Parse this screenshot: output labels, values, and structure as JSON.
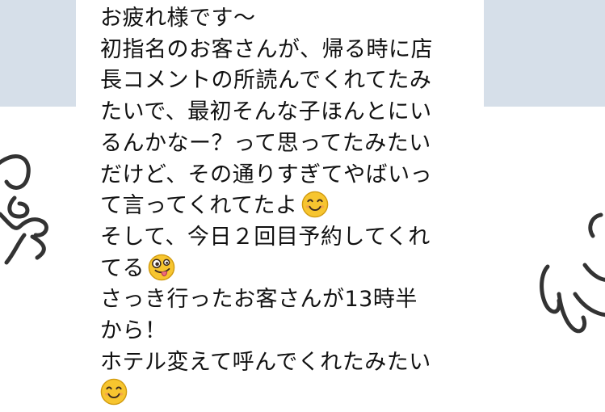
{
  "message": {
    "lines": [
      "お疲れ様です〜",
      "初指名のお客さんが、帰る時に店",
      "長コメントの所読んでくれてたみ",
      "たいで、最初そんな子ほんとにい",
      "るんかなー？って思ってたみたい",
      "だけど、その通りすぎてやばいっ",
      "て言ってくれてたよ",
      "そして、今日２回目予約してくれ",
      "てる",
      "さっき行ったお客さんが13時半",
      "から！",
      "ホテル変えて呼んでくれたみたい",
      ""
    ],
    "emojis": {
      "line7": "smiling-face-emoji",
      "line9": "zany-face-emoji",
      "line13": "smiling-face-emoji"
    }
  },
  "colors": {
    "background_band": "#d6dfe9",
    "bubble": "#ffffff",
    "text": "#111111",
    "emoji_face": "#f7c52f",
    "sticker_stroke": "#333333"
  }
}
